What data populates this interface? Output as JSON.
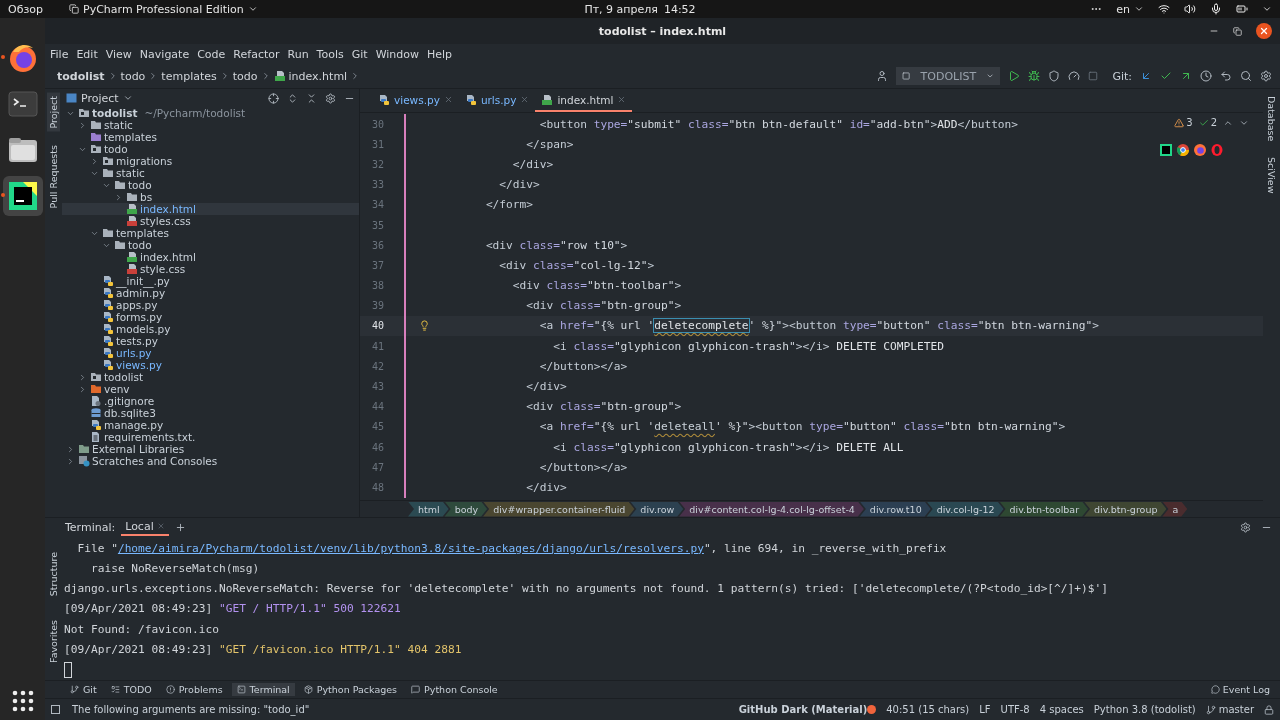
{
  "system_bar": {
    "activities": "Обзор",
    "app_menu": "PyCharm Professional Edition",
    "date": "Пт, 9 апреля",
    "time": "14:52",
    "language": "en"
  },
  "dock": [
    {
      "kind": "firefox",
      "running": true,
      "selected": false
    },
    {
      "kind": "terminal",
      "running": false,
      "selected": false
    },
    {
      "kind": "files",
      "running": false,
      "selected": false
    },
    {
      "kind": "pycharm",
      "running": true,
      "selected": true
    }
  ],
  "window": {
    "title": "todolist – index.html"
  },
  "menu": [
    "File",
    "Edit",
    "View",
    "Navigate",
    "Code",
    "Refactor",
    "Run",
    "Tools",
    "Git",
    "Window",
    "Help"
  ],
  "nav_path": [
    {
      "label": "todolist",
      "kind": "folder"
    },
    {
      "label": "todo",
      "kind": "folder"
    },
    {
      "label": "templates",
      "kind": "folder"
    },
    {
      "label": "todo",
      "kind": "folder"
    },
    {
      "label": "index.html",
      "kind": "html"
    }
  ],
  "toolbar": {
    "run_config": "TODOLIST",
    "git_label": "Git:"
  },
  "left_stripe": [
    {
      "label": "Project",
      "selected": true
    },
    {
      "label": "Pull Requests",
      "selected": false
    }
  ],
  "right_stripe": [
    {
      "label": "Database"
    },
    {
      "label": "SciView"
    }
  ],
  "project": {
    "title": "Project",
    "tree": [
      {
        "name": "todolist",
        "hint": "~/Pycharm/todolist",
        "kind": "folder_module",
        "expanded": true,
        "selected": false,
        "modified": false,
        "children": [
          {
            "name": "static",
            "kind": "folder",
            "expanded": false,
            "selected": false,
            "modified": false
          },
          {
            "name": "templates",
            "kind": "folder_templates",
            "selected": false,
            "modified": false
          },
          {
            "name": "todo",
            "kind": "folder_module",
            "expanded": true,
            "selected": false,
            "modified": false,
            "children": [
              {
                "name": "migrations",
                "kind": "folder_module",
                "expanded": false,
                "selected": false,
                "modified": false
              },
              {
                "name": "static",
                "kind": "folder",
                "expanded": true,
                "selected": false,
                "modified": false,
                "children": [
                  {
                    "name": "todo",
                    "kind": "folder",
                    "expanded": true,
                    "selected": false,
                    "modified": false,
                    "children": [
                      {
                        "name": "bs",
                        "kind": "folder",
                        "expanded": false,
                        "selected": false,
                        "modified": false
                      },
                      {
                        "name": "index.html",
                        "kind": "html",
                        "selected": true,
                        "modified": true
                      },
                      {
                        "name": "styles.css",
                        "kind": "css",
                        "selected": false,
                        "modified": false
                      }
                    ]
                  }
                ]
              },
              {
                "name": "templates",
                "kind": "folder",
                "expanded": true,
                "selected": false,
                "modified": false,
                "children": [
                  {
                    "name": "todo",
                    "kind": "folder",
                    "expanded": true,
                    "selected": false,
                    "modified": false,
                    "children": [
                      {
                        "name": "index.html",
                        "kind": "html",
                        "selected": false,
                        "modified": false
                      },
                      {
                        "name": "style.css",
                        "kind": "css",
                        "selected": false,
                        "modified": false
                      }
                    ]
                  }
                ]
              },
              {
                "name": "__init__.py",
                "kind": "py",
                "selected": false,
                "modified": false
              },
              {
                "name": "admin.py",
                "kind": "py",
                "selected": false,
                "modified": false
              },
              {
                "name": "apps.py",
                "kind": "py",
                "selected": false,
                "modified": false
              },
              {
                "name": "forms.py",
                "kind": "py",
                "selected": false,
                "modified": false
              },
              {
                "name": "models.py",
                "kind": "py",
                "selected": false,
                "modified": false
              },
              {
                "name": "tests.py",
                "kind": "py",
                "selected": false,
                "modified": false
              },
              {
                "name": "urls.py",
                "kind": "py",
                "selected": false,
                "modified": true
              },
              {
                "name": "views.py",
                "kind": "py",
                "selected": false,
                "modified": true
              }
            ]
          },
          {
            "name": "todolist",
            "kind": "folder_module",
            "expanded": false,
            "selected": false,
            "modified": false
          },
          {
            "name": "venv",
            "kind": "folder_excluded",
            "expanded": false,
            "selected": false,
            "modified": false
          },
          {
            "name": ".gitignore",
            "kind": "ignore",
            "selected": false,
            "modified": false
          },
          {
            "name": "db.sqlite3",
            "kind": "db",
            "selected": false,
            "modified": false
          },
          {
            "name": "manage.py",
            "kind": "py",
            "selected": false,
            "modified": false
          },
          {
            "name": "requirements.txt.",
            "kind": "txt",
            "selected": false,
            "modified": false
          }
        ]
      },
      {
        "name": "External Libraries",
        "kind": "library",
        "expanded": false,
        "selected": false,
        "modified": false
      },
      {
        "name": "Scratches and Consoles",
        "kind": "scratch",
        "expanded": false,
        "selected": false,
        "modified": false
      }
    ]
  },
  "editor_tabs": [
    {
      "label": "views.py",
      "kind": "py",
      "selected": false,
      "modified": true
    },
    {
      "label": "urls.py",
      "kind": "py",
      "selected": false,
      "modified": true
    },
    {
      "label": "index.html",
      "kind": "html",
      "selected": true,
      "modified": false
    }
  ],
  "inspections": {
    "warnings": "3",
    "weak_warnings": "2"
  },
  "code": [
    {
      "number": "30",
      "current": false,
      "segments": [
        {
          "kind": "tag",
          "text": "                <button"
        },
        {
          "kind": "attr",
          "text": " type="
        },
        {
          "kind": "str",
          "text": "\"submit\""
        },
        {
          "kind": "attr",
          "text": " class="
        },
        {
          "kind": "str",
          "text": "\"btn btn-default\""
        },
        {
          "kind": "attr",
          "text": " id="
        },
        {
          "kind": "str",
          "text": "\"add-btn\""
        },
        {
          "kind": "tag",
          "text": ">"
        },
        {
          "kind": "text",
          "text": "ADD"
        },
        {
          "kind": "tag",
          "text": "</button>"
        }
      ]
    },
    {
      "number": "31",
      "current": false,
      "segments": [
        {
          "kind": "tag",
          "text": "              </span>"
        }
      ]
    },
    {
      "number": "32",
      "current": false,
      "segments": [
        {
          "kind": "tag",
          "text": "            </div>"
        }
      ]
    },
    {
      "number": "33",
      "current": false,
      "segments": [
        {
          "kind": "tag",
          "text": "          </div>"
        }
      ]
    },
    {
      "number": "34",
      "current": false,
      "segments": [
        {
          "kind": "tag",
          "text": "        </form>"
        }
      ]
    },
    {
      "number": "35",
      "current": false
    },
    {
      "number": "36",
      "current": false,
      "segments": [
        {
          "kind": "tag",
          "text": "        <div"
        },
        {
          "kind": "attr",
          "text": " class="
        },
        {
          "kind": "str",
          "text": "\"row t10\""
        },
        {
          "kind": "tag",
          "text": ">"
        }
      ]
    },
    {
      "number": "37",
      "current": false,
      "segments": [
        {
          "kind": "tag",
          "text": "          <div"
        },
        {
          "kind": "attr",
          "text": " class="
        },
        {
          "kind": "str",
          "text": "\"col-lg-12\""
        },
        {
          "kind": "tag",
          "text": ">"
        }
      ]
    },
    {
      "number": "38",
      "current": false,
      "segments": [
        {
          "kind": "tag",
          "text": "            <div"
        },
        {
          "kind": "attr",
          "text": " class="
        },
        {
          "kind": "str",
          "text": "\"btn-toolbar\""
        },
        {
          "kind": "tag",
          "text": ">"
        }
      ]
    },
    {
      "number": "39",
      "current": false,
      "segments": [
        {
          "kind": "tag",
          "text": "              <div"
        },
        {
          "kind": "attr",
          "text": " class="
        },
        {
          "kind": "str",
          "text": "\"btn-group\""
        },
        {
          "kind": "tag",
          "text": ">"
        }
      ]
    },
    {
      "number": "40",
      "current": true,
      "segments": [
        {
          "kind": "tag",
          "text": "                <a"
        },
        {
          "kind": "attr",
          "text": " href="
        },
        {
          "kind": "str",
          "text": "\"{% url '"
        },
        {
          "kind": "ref_selected",
          "text": "deletecomplete"
        },
        {
          "kind": "str",
          "text": "' %}\""
        },
        {
          "kind": "tag",
          "text": "><button"
        },
        {
          "kind": "attr",
          "text": " type="
        },
        {
          "kind": "str",
          "text": "\"button\""
        },
        {
          "kind": "attr",
          "text": " class="
        },
        {
          "kind": "str",
          "text": "\"btn btn-warning\""
        },
        {
          "kind": "tag",
          "text": ">"
        }
      ]
    },
    {
      "number": "41",
      "current": false,
      "segments": [
        {
          "kind": "tag",
          "text": "                  <i"
        },
        {
          "kind": "attr",
          "text": " class="
        },
        {
          "kind": "str",
          "text": "\"glyphicon glyphicon-trash\""
        },
        {
          "kind": "tag",
          "text": "></i>"
        },
        {
          "kind": "text",
          "text": " DELETE COMPLETED"
        }
      ]
    },
    {
      "number": "42",
      "current": false,
      "segments": [
        {
          "kind": "tag",
          "text": "                </button></a>"
        }
      ]
    },
    {
      "number": "43",
      "current": false,
      "segments": [
        {
          "kind": "tag",
          "text": "              </div>"
        }
      ]
    },
    {
      "number": "44",
      "current": false,
      "segments": [
        {
          "kind": "tag",
          "text": "              <div"
        },
        {
          "kind": "attr",
          "text": " class="
        },
        {
          "kind": "str",
          "text": "\"btn-group\""
        },
        {
          "kind": "tag",
          "text": ">"
        }
      ]
    },
    {
      "number": "45",
      "current": false,
      "segments": [
        {
          "kind": "tag",
          "text": "                <a"
        },
        {
          "kind": "attr",
          "text": " href="
        },
        {
          "kind": "str",
          "text": "\"{% url '"
        },
        {
          "kind": "ref",
          "text": "deleteall"
        },
        {
          "kind": "str",
          "text": "' %}\""
        },
        {
          "kind": "tag",
          "text": "><button"
        },
        {
          "kind": "attr",
          "text": " type="
        },
        {
          "kind": "str",
          "text": "\"button\""
        },
        {
          "kind": "attr",
          "text": " class="
        },
        {
          "kind": "str",
          "text": "\"btn btn-warning\""
        },
        {
          "kind": "tag",
          "text": ">"
        }
      ]
    },
    {
      "number": "46",
      "current": false,
      "segments": [
        {
          "kind": "tag",
          "text": "                  <i"
        },
        {
          "kind": "attr",
          "text": " class="
        },
        {
          "kind": "str",
          "text": "\"glyphicon glyphicon-trash\""
        },
        {
          "kind": "tag",
          "text": "></i>"
        },
        {
          "kind": "text",
          "text": " DELETE ALL"
        }
      ]
    },
    {
      "number": "47",
      "current": false,
      "segments": [
        {
          "kind": "tag",
          "text": "                </button></a>"
        }
      ]
    },
    {
      "number": "48",
      "current": false,
      "segments": [
        {
          "kind": "tag",
          "text": "              </div>"
        }
      ]
    }
  ],
  "tag_path": [
    {
      "label": "html",
      "color": "#2b4a52"
    },
    {
      "label": "body",
      "color": "#2e4a3c"
    },
    {
      "label": "div#wrapper.container-fluid",
      "color": "#4a4630"
    },
    {
      "label": "div.row",
      "color": "#2c4150"
    },
    {
      "label": "div#content.col-lg-4.col-lg-offset-4",
      "color": "#48304a"
    },
    {
      "label": "div.row.t10",
      "color": "#2c3f52"
    },
    {
      "label": "div.col-lg-12",
      "color": "#2a4852"
    },
    {
      "label": "div.btn-toolbar",
      "color": "#2e4832"
    },
    {
      "label": "div.btn-group",
      "color": "#3f4632"
    },
    {
      "label": "a",
      "color": "#4a2c2e"
    }
  ],
  "terminal": {
    "title": "Terminal:",
    "tabs": [
      {
        "label": "Local",
        "selected": true
      }
    ],
    "lines": [
      [
        {
          "kind": "plain",
          "text": "  File \""
        },
        {
          "kind": "link",
          "text": "/home/aimira/Pycharm/todolist/venv/lib/python3.8/site-packages/django/urls/resolvers.py"
        },
        {
          "kind": "plain",
          "text": "\", line 694, in _reverse_with_prefix"
        }
      ],
      [
        {
          "kind": "plain",
          "text": "    raise NoReverseMatch(msg)"
        }
      ],
      [
        {
          "kind": "plain",
          "text": "django.urls.exceptions.NoReverseMatch: Reverse for 'deletecomplete' with no arguments not found. 1 pattern(s) tried: ['deletecomplete/(?P<todo_id>[^/]+)$']"
        }
      ],
      [
        {
          "kind": "plain",
          "text": "[09/Apr/2021 08:49:23] "
        },
        {
          "kind": "error",
          "text": "\"GET / HTTP/1.1\" 500 122621"
        }
      ],
      [
        {
          "kind": "plain",
          "text": "Not Found: /favicon.ico"
        }
      ],
      [
        {
          "kind": "plain",
          "text": "[09/Apr/2021 08:49:23] "
        },
        {
          "kind": "warning",
          "text": "\"GET /favicon.ico HTTP/1.1\" 404 2881"
        }
      ]
    ],
    "side_labels": [
      "Structure",
      "Favorites"
    ]
  },
  "tool_windows": [
    {
      "label": "Git",
      "kind": "git",
      "selected": false
    },
    {
      "label": "TODO",
      "kind": "todo",
      "selected": false
    },
    {
      "label": "Problems",
      "kind": "problems",
      "selected": false
    },
    {
      "label": "Terminal",
      "kind": "terminal",
      "selected": true
    },
    {
      "label": "Python Packages",
      "kind": "packages",
      "selected": false
    },
    {
      "label": "Python Console",
      "kind": "console",
      "selected": false
    }
  ],
  "event_log": "Event Log",
  "status_bar": {
    "message": "The following arguments are missing: \"todo_id\"",
    "theme": "GitHub Dark (Material)",
    "position": "40:51 (15 chars)",
    "line_separator": "LF",
    "encoding": "UTF-8",
    "indent": "4 spaces",
    "interpreter": "Python 3.8 (todolist)",
    "branch": "master"
  }
}
